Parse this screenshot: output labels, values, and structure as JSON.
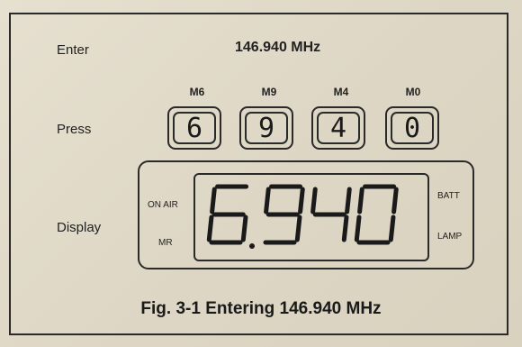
{
  "labels": {
    "enter": "Enter",
    "press": "Press",
    "display": "Display"
  },
  "frequency": "146.940 MHz",
  "keys": [
    {
      "memory": "M6",
      "digit": "6"
    },
    {
      "memory": "M9",
      "digit": "9"
    },
    {
      "memory": "M4",
      "digit": "4"
    },
    {
      "memory": "M0",
      "digit": "0"
    }
  ],
  "lcd": {
    "readout": "6.940",
    "indicators": {
      "on_air": "ON AIR",
      "mr": "MR",
      "batt": "BATT",
      "lamp": "LAMP"
    }
  },
  "caption": "Fig. 3-1 Entering 146.940 MHz"
}
